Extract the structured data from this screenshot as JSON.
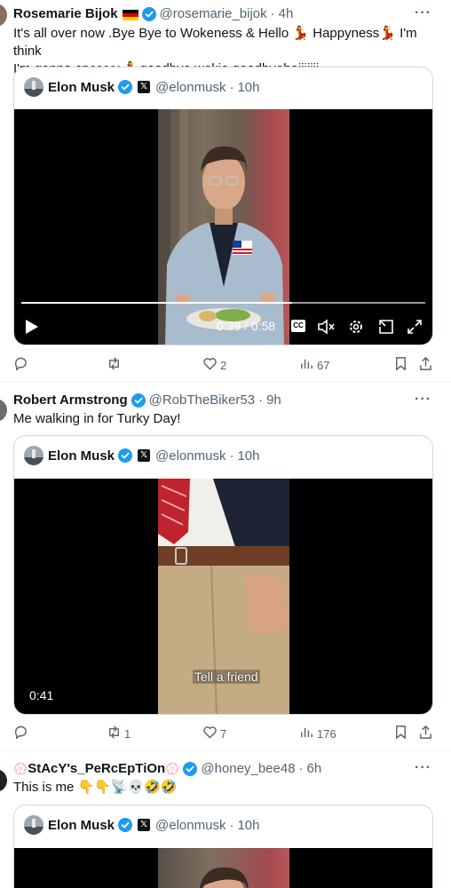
{
  "tweets": [
    {
      "name": "Rosemarie Bijok",
      "handle": "@rosemarie_bijok",
      "time": "4h",
      "text_line1": "It's all over now .Bye Bye to Wokeness & Hello 💃 Happyness💃 I'm think",
      "text_line2": "I'm gonna cryyyyy 💃goodbye wokie goodbyeheiiiiiii",
      "quote": {
        "name": "Elon Musk",
        "handle": "@elonmusk",
        "time": "10h"
      },
      "video": {
        "time_display": "0:39 / 0:58",
        "cc": "CC"
      },
      "actions": {
        "replies": "",
        "reposts": "",
        "likes": "2",
        "views": "67"
      }
    },
    {
      "name": "Robert Armstrong",
      "handle": "@RobTheBiker53",
      "time": "9h",
      "text_line1": "Me walking in for Turky Day!",
      "quote": {
        "name": "Elon Musk",
        "handle": "@elonmusk",
        "time": "10h"
      },
      "video": {
        "duration": "0:41",
        "caption": "Tell a friend"
      },
      "actions": {
        "replies": "",
        "reposts": "1",
        "likes": "7",
        "views": "176"
      }
    },
    {
      "name": "StAcY's_PeRcEpTiOn",
      "name_deco": "💮",
      "handle": "@honey_bee48",
      "time": "6h",
      "text_line1": "This is me 👇👇📡💀🤣🤣",
      "quote": {
        "name": "Elon Musk",
        "handle": "@elonmusk",
        "time": "10h"
      }
    }
  ],
  "separator": "·",
  "more": "···",
  "colors": {
    "verified": "#1d9bf0",
    "muted": "#536471",
    "border": "#cfd9de"
  }
}
